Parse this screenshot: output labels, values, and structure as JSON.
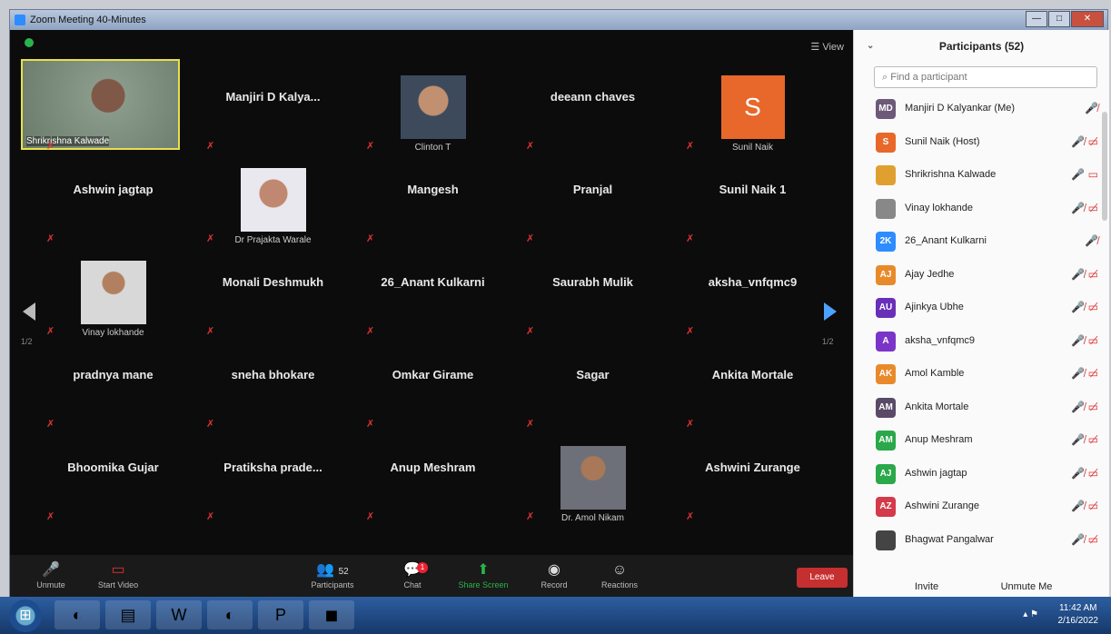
{
  "window": {
    "title": "Zoom Meeting 40-Minutes",
    "controls": [
      "—",
      "□",
      "✕"
    ]
  },
  "meeting": {
    "view_label": "View",
    "page_left": "1/2",
    "page_right": "1/2",
    "active_speaker": "Shrikrishna Kalwade",
    "tiles": [
      {
        "name": "",
        "caption": "Shrikrishna Kalwade",
        "type": "big"
      },
      {
        "name": "Manjiri D Kalya...",
        "caption": ""
      },
      {
        "name": "",
        "caption": "Clinton T",
        "type": "photo",
        "photo": "face1"
      },
      {
        "name": "deeann chaves",
        "caption": ""
      },
      {
        "name": "",
        "caption": "Sunil Naik",
        "type": "avatar",
        "letter": "S"
      },
      {
        "name": "Ashwin jagtap",
        "caption": ""
      },
      {
        "name": "",
        "caption": "Dr Prajakta Warale",
        "type": "photo",
        "photo": "face2"
      },
      {
        "name": "Mangesh",
        "caption": ""
      },
      {
        "name": "Pranjal",
        "caption": ""
      },
      {
        "name": "Sunil Naik 1",
        "caption": ""
      },
      {
        "name": "",
        "caption": "Vinay lokhande",
        "type": "photo",
        "photo": "face3"
      },
      {
        "name": "Monali Deshmukh",
        "caption": ""
      },
      {
        "name": "26_Anant Kulkarni",
        "caption": ""
      },
      {
        "name": "Saurabh Mulik",
        "caption": ""
      },
      {
        "name": "aksha_vnfqmc9",
        "caption": ""
      },
      {
        "name": "pradnya mane",
        "caption": ""
      },
      {
        "name": "sneha bhokare",
        "caption": ""
      },
      {
        "name": "Omkar Girame",
        "caption": ""
      },
      {
        "name": "Sagar",
        "caption": ""
      },
      {
        "name": "Ankita Mortale",
        "caption": ""
      },
      {
        "name": "Bhoomika Gujar",
        "caption": ""
      },
      {
        "name": "Pratiksha prade...",
        "caption": ""
      },
      {
        "name": "Anup Meshram",
        "caption": ""
      },
      {
        "name": "",
        "caption": "Dr. Amol Nikam",
        "type": "photo",
        "photo": "face4"
      },
      {
        "name": "Ashwini Zurange",
        "caption": ""
      }
    ]
  },
  "toolbar": {
    "unmute": "Unmute",
    "start_video": "Start Video",
    "participants": "Participants",
    "participants_count": "52",
    "chat": "Chat",
    "chat_badge": "1",
    "share_screen": "Share Screen",
    "record": "Record",
    "reactions": "Reactions",
    "leave": "Leave"
  },
  "panel": {
    "title": "Participants (52)",
    "search_placeholder": "Find a participant",
    "invite": "Invite",
    "unmute_me": "Unmute Me",
    "participants": [
      {
        "initials": "MD",
        "name": "Manjiri D Kalyankar (Me)",
        "color": "#6c5a78",
        "icons": "🎤̸"
      },
      {
        "initials": "S",
        "name": "Sunil Naik (Host)",
        "color": "#e7682a",
        "icons": "🎤̸ ▭̸"
      },
      {
        "initials": "",
        "name": "Shrikrishna Kalwade",
        "color": "#e0a030",
        "icons": "🎤 ▭"
      },
      {
        "initials": "",
        "name": "Vinay lokhande",
        "color": "#888",
        "icons": "🎤̸ ▭̸"
      },
      {
        "initials": "2K",
        "name": "26_Anant Kulkarni",
        "color": "#2d8cff",
        "icons": "🎤̸"
      },
      {
        "initials": "AJ",
        "name": "Ajay Jedhe",
        "color": "#e88a2a",
        "icons": "🎤̸ ▭̸"
      },
      {
        "initials": "AU",
        "name": "Ajinkya Ubhe",
        "color": "#6a2fb8",
        "icons": "🎤̸ ▭̸"
      },
      {
        "initials": "A",
        "name": "aksha_vnfqmc9",
        "color": "#7a35c8",
        "icons": "🎤̸ ▭̸"
      },
      {
        "initials": "AK",
        "name": "Amol Kamble",
        "color": "#e88a2a",
        "icons": "🎤̸ ▭̸"
      },
      {
        "initials": "AM",
        "name": "Ankita Mortale",
        "color": "#5a4a68",
        "icons": "🎤̸ ▭̸"
      },
      {
        "initials": "AM",
        "name": "Anup Meshram",
        "color": "#2aa84a",
        "icons": "🎤̸ ▭̸"
      },
      {
        "initials": "AJ",
        "name": "Ashwin jagtap",
        "color": "#2aa84a",
        "icons": "🎤̸ ▭̸"
      },
      {
        "initials": "AZ",
        "name": "Ashwini Zurange",
        "color": "#d43a4a",
        "icons": "🎤̸ ▭̸"
      },
      {
        "initials": "",
        "name": "Bhagwat Pangalwar",
        "color": "#444",
        "icons": "🎤̸ ▭̸"
      }
    ]
  },
  "taskbar": {
    "time": "11:42 AM",
    "date": "2/16/2022"
  }
}
